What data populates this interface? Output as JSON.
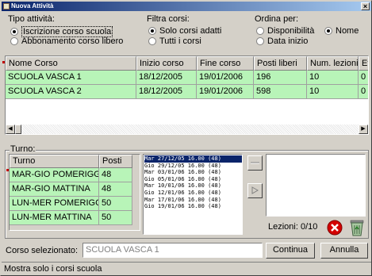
{
  "window": {
    "title": "Nuova Attività"
  },
  "tipo_attivita": {
    "label": "Tipo attività:",
    "options": [
      {
        "label": "Iscrizione corso scuola",
        "checked": true
      },
      {
        "label": "Abbonamento corso libero",
        "checked": false
      }
    ]
  },
  "filtra_corsi": {
    "label": "Filtra corsi:",
    "options": [
      {
        "label": "Solo corsi adatti",
        "checked": true
      },
      {
        "label": "Tutti i corsi",
        "checked": false
      }
    ]
  },
  "ordina_per": {
    "label": "Ordina per:",
    "options": [
      {
        "label": "Disponibilità",
        "checked": false
      },
      {
        "label": "Nome",
        "checked": true
      },
      {
        "label": "Data inizio",
        "checked": false
      }
    ]
  },
  "courses": {
    "columns": [
      "Nome Corso",
      "Inizio corso",
      "Fine corso",
      "Posti liberi",
      "Num. lezioni",
      "Et"
    ],
    "rows": [
      [
        "SCUOLA VASCA 1",
        "18/12/2005",
        "19/01/2006",
        "196",
        "10",
        "0"
      ],
      [
        "SCUOLA VASCA 2",
        "18/12/2005",
        "19/01/2006",
        "598",
        "10",
        "0"
      ]
    ]
  },
  "turno": {
    "label": "Turno:",
    "columns": [
      "Turno",
      "Posti"
    ],
    "rows": [
      [
        "MAR-GIO POMERIGGIO",
        "48"
      ],
      [
        "MAR-GIO MATTINA",
        "48"
      ],
      [
        "LUN-MER POMERIGGIO",
        "50"
      ],
      [
        "LUN-MER MATTINA",
        "50"
      ]
    ]
  },
  "dates": [
    {
      "text": "Mar 27/12/05 16.00 (48)",
      "selected": true
    },
    {
      "text": "Gio 29/12/05 16.00 (48)",
      "selected": false
    },
    {
      "text": "Mar 03/01/06 16.00 (48)",
      "selected": false
    },
    {
      "text": "Gio 05/01/06 16.00 (48)",
      "selected": false
    },
    {
      "text": "Mar 10/01/06 16.00 (48)",
      "selected": false
    },
    {
      "text": "Gio 12/01/06 16.00 (48)",
      "selected": false
    },
    {
      "text": "Mar 17/01/06 16.00 (48)",
      "selected": false
    },
    {
      "text": "Gio 19/01/06 16.00 (48)",
      "selected": false
    }
  ],
  "lezioni": "Lezioni: 0/10",
  "corso_selezionato": {
    "label": "Corso selezionato:",
    "value": "SCUOLA VASCA 1"
  },
  "buttons": {
    "continua": "Continua",
    "annulla": "Annulla"
  },
  "status": "Mostra solo i corsi scuola",
  "colors": {
    "row_bg": "#b8f4b8",
    "title_start": "#0a246a",
    "title_end": "#a6caf0",
    "selection": "#0a246a"
  },
  "icons": {
    "delete": "delete-red-x-icon",
    "clear": "recycle-bin-icon",
    "add_one": "add-single-icon",
    "add_all": "add-all-icon"
  }
}
